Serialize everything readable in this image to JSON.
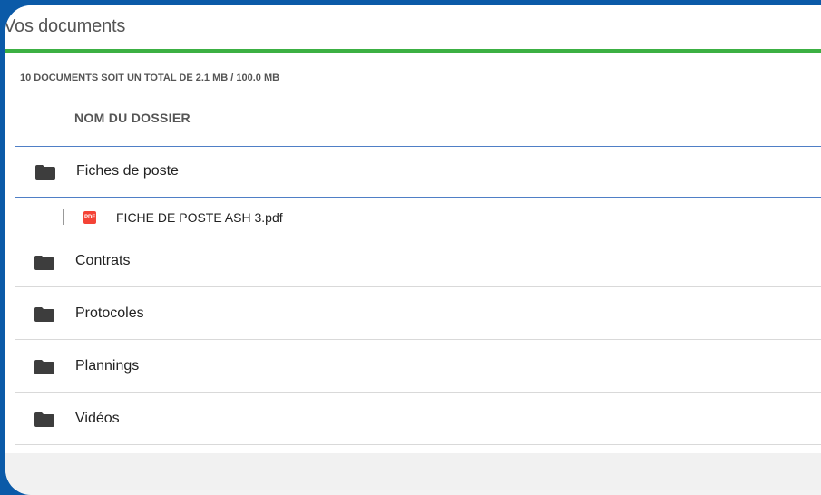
{
  "panel": {
    "title": "Vos documents",
    "accent_color": "#3cb043",
    "background_color": "#0b5aa8"
  },
  "summary": {
    "text": "10 DOCUMENTS SOIT UN TOTAL DE 2.1 MB / 100.0 MB"
  },
  "table": {
    "column_header": "NOM DU DOSSIER",
    "folders": [
      {
        "label": "Fiches de poste",
        "icon": "folder-icon",
        "state": "expanded-selected"
      },
      {
        "label": "Contrats",
        "icon": "folder-icon",
        "state": "collapsed"
      },
      {
        "label": "Protocoles",
        "icon": "folder-icon",
        "state": "collapsed"
      },
      {
        "label": "Plannings",
        "icon": "folder-icon",
        "state": "collapsed"
      },
      {
        "label": "Vidéos",
        "icon": "folder-icon",
        "state": "collapsed"
      }
    ],
    "files": [
      {
        "label": "FICHE DE POSTE ASH 3.pdf",
        "icon": "pdf-icon",
        "badge": "PDF",
        "badge_color": "#f44336"
      }
    ]
  }
}
